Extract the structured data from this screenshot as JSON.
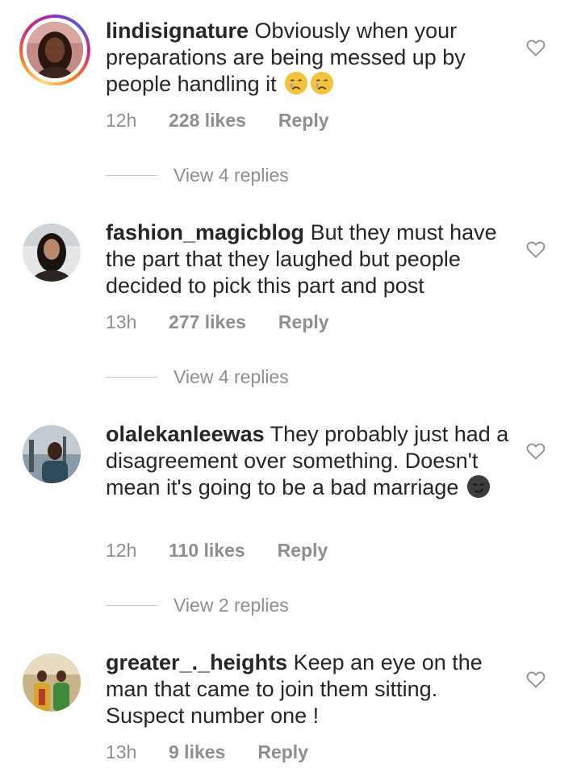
{
  "comments": [
    {
      "username": "lindisignature",
      "text": "Obviously when your preparations are being messed up by people handling it",
      "emoji": [
        "crying-face",
        "crying-face"
      ],
      "time": "12h",
      "likes": "228 likes",
      "reply_label": "Reply",
      "view_replies": "View 4 replies",
      "avatar_icon": "user-avatar"
    },
    {
      "username": "fashion_magicblog",
      "text": "But they must have the part that they  laughed but people decided to pick this part and post",
      "emoji": [],
      "time": "13h",
      "likes": "277 likes",
      "reply_label": "Reply",
      "view_replies": "View 4 replies",
      "avatar_icon": "user-avatar"
    },
    {
      "username": "olalekanleewas",
      "text": "They probably just had a disagreement over something. Doesn't mean it's going to be a bad marriage",
      "emoji": [
        "smirk-face"
      ],
      "time": "12h",
      "likes": "110 likes",
      "reply_label": "Reply",
      "view_replies": "View 2 replies",
      "avatar_icon": "user-avatar"
    },
    {
      "username": "greater_._heights",
      "text": "Keep an eye on the man that came to join them sitting. Suspect number one !",
      "emoji": [],
      "time": "13h",
      "likes": "9 likes",
      "reply_label": "Reply",
      "view_replies": "",
      "avatar_icon": "user-avatar"
    }
  ],
  "colors": {
    "text": "#262626",
    "meta": "#8e8e8e",
    "divider": "#c7c7c7",
    "story_ring": [
      "#feda75",
      "#fa7e1e",
      "#d62976",
      "#962fbf",
      "#4f5bd5"
    ]
  },
  "icons": {
    "like": "heart-outline-icon"
  }
}
